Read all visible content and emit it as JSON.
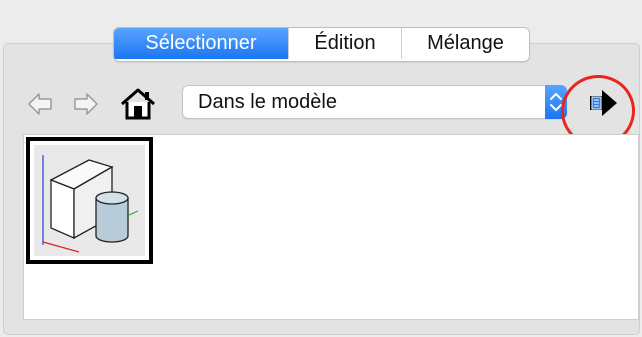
{
  "tabs": [
    {
      "label": "Sélectionner",
      "active": true
    },
    {
      "label": "Édition",
      "active": false
    },
    {
      "label": "Mélange",
      "active": false
    }
  ],
  "toolbar": {
    "back_icon": "back-arrow-icon",
    "forward_icon": "forward-arrow-icon",
    "home_icon": "home-icon",
    "details_icon": "details-arrow-icon"
  },
  "collection_select": {
    "value": "Dans le modèle"
  },
  "materials": [
    {
      "name": "component-thumbnail"
    }
  ],
  "colors": {
    "accent": "#1a76f2",
    "highlight": "#e8261f"
  }
}
